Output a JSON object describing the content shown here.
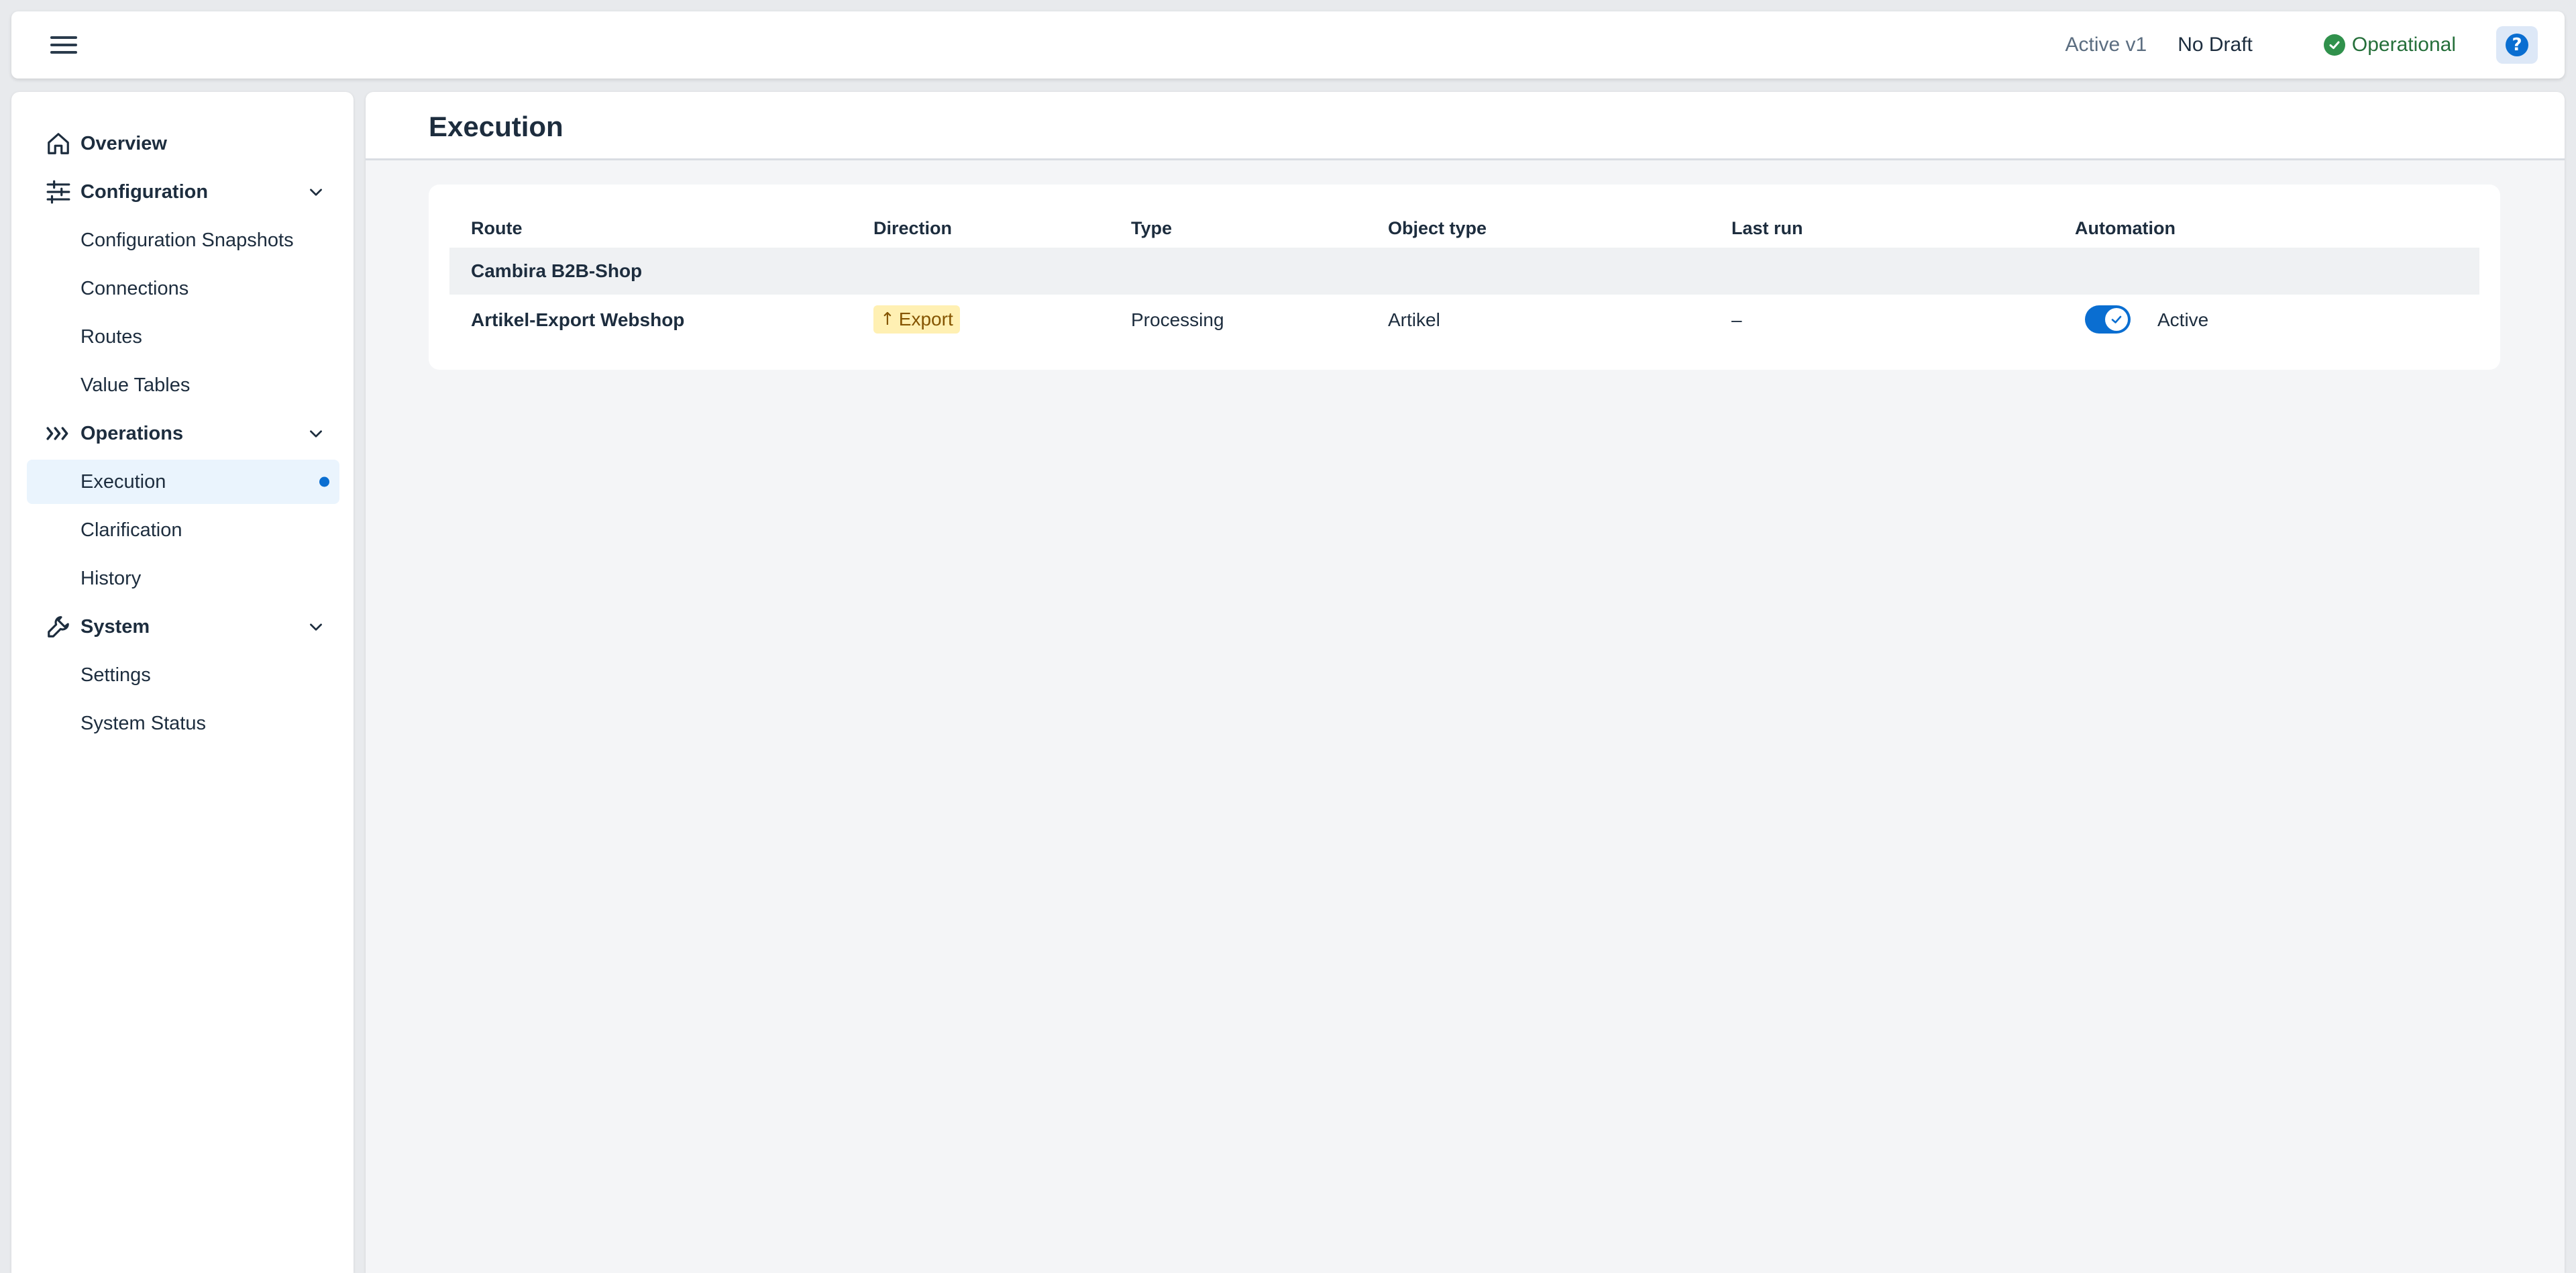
{
  "header": {
    "version": "Active v1",
    "draft": "No Draft",
    "status": "Operational",
    "colors": {
      "status_green": "#30914c",
      "accent": "#0a6ed1"
    }
  },
  "sidebar": {
    "overview": "Overview",
    "configuration": {
      "label": "Configuration",
      "items": [
        "Configuration Snapshots",
        "Connections",
        "Routes",
        "Value Tables"
      ]
    },
    "operations": {
      "label": "Operations",
      "items": [
        "Execution",
        "Clarification",
        "History"
      ]
    },
    "system": {
      "label": "System",
      "items": [
        "Settings",
        "System Status"
      ]
    }
  },
  "page": {
    "title": "Execution"
  },
  "table": {
    "columns": [
      "Route",
      "Direction",
      "Type",
      "Object type",
      "Last run",
      "Automation"
    ],
    "group": "Cambira B2B-Shop",
    "row": {
      "route": "Artikel-Export Webshop",
      "direction_icon": "↑",
      "direction": "Export",
      "type": "Processing",
      "object_type": "Artikel",
      "last_run": "–",
      "automation": "Active"
    }
  }
}
